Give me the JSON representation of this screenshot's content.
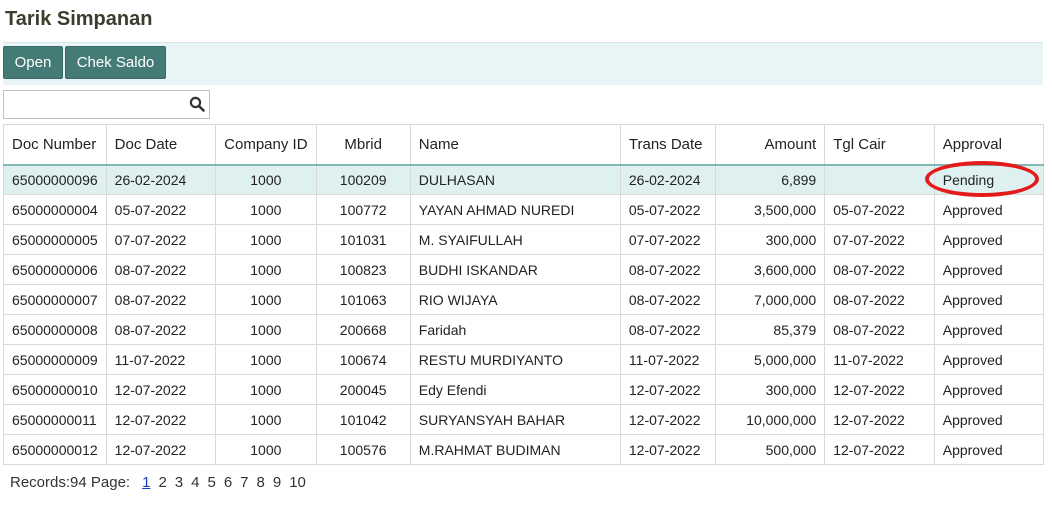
{
  "header": {
    "title": "Tarik Simpanan"
  },
  "toolbar": {
    "open_label": "Open",
    "saldo_label": "Chek Saldo"
  },
  "search": {
    "value": "",
    "icon": "search-icon"
  },
  "table": {
    "columns": [
      "Doc Number",
      "Doc Date",
      "Company ID",
      "Mbrid",
      "Name",
      "Trans Date",
      "Amount",
      "Tgl Cair",
      "Approval"
    ],
    "rows": [
      [
        "65000000096",
        "26-02-2024",
        "1000",
        "100209",
        "DULHASAN",
        "26-02-2024",
        "6,899",
        "",
        "Pending"
      ],
      [
        "65000000004",
        "05-07-2022",
        "1000",
        "100772",
        "YAYAN AHMAD NUREDI",
        "05-07-2022",
        "3,500,000",
        "05-07-2022",
        "Approved"
      ],
      [
        "65000000005",
        "07-07-2022",
        "1000",
        "101031",
        "M. SYAIFULLAH",
        "07-07-2022",
        "300,000",
        "07-07-2022",
        "Approved"
      ],
      [
        "65000000006",
        "08-07-2022",
        "1000",
        "100823",
        "BUDHI ISKANDAR",
        "08-07-2022",
        "3,600,000",
        "08-07-2022",
        "Approved"
      ],
      [
        "65000000007",
        "08-07-2022",
        "1000",
        "101063",
        "RIO WIJAYA",
        "08-07-2022",
        "7,000,000",
        "08-07-2022",
        "Approved"
      ],
      [
        "65000000008",
        "08-07-2022",
        "1000",
        "200668",
        "Faridah",
        "08-07-2022",
        "85,379",
        "08-07-2022",
        "Approved"
      ],
      [
        "65000000009",
        "11-07-2022",
        "1000",
        "100674",
        "RESTU MURDIYANTO",
        "11-07-2022",
        "5,000,000",
        "11-07-2022",
        "Approved"
      ],
      [
        "65000000010",
        "12-07-2022",
        "1000",
        "200045",
        "Edy Efendi",
        "12-07-2022",
        "300,000",
        "12-07-2022",
        "Approved"
      ],
      [
        "65000000011",
        "12-07-2022",
        "1000",
        "101042",
        "SURYANSYAH BAHAR",
        "12-07-2022",
        "10,000,000",
        "12-07-2022",
        "Approved"
      ],
      [
        "65000000012",
        "12-07-2022",
        "1000",
        "100576",
        "M.RAHMAT BUDIMAN",
        "12-07-2022",
        "500,000",
        "12-07-2022",
        "Approved"
      ]
    ],
    "selected_row": 0
  },
  "pager": {
    "records_label": "Records:94",
    "page_label": "Page:",
    "pages": [
      "1",
      "2",
      "3",
      "4",
      "5",
      "6",
      "7",
      "8",
      "9",
      "10"
    ],
    "current_page": "1"
  },
  "colors": {
    "accent": "#457b77",
    "toolbar_bg": "#e8f4f5",
    "selected_row": "#dff0f0",
    "annotation": "#e31b1b",
    "link": "#1a3fbf"
  }
}
